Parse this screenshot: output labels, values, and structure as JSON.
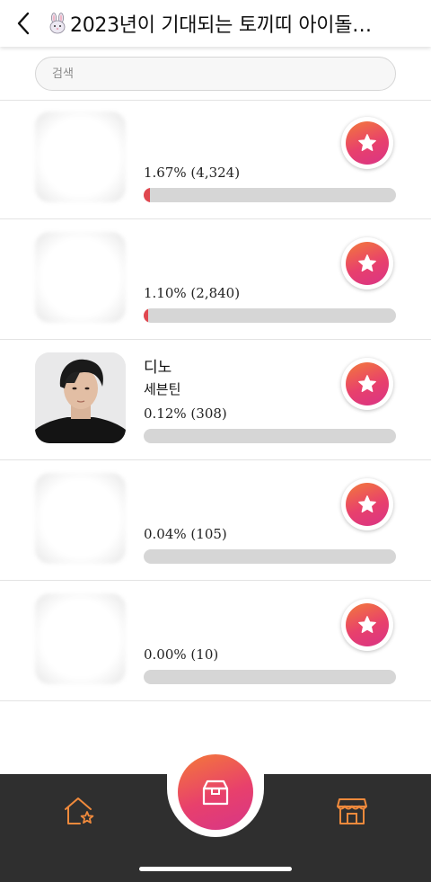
{
  "header": {
    "title": "2023년이 기대되는 토끼띠 아이돌…",
    "title_icon": "rabbit-emoji-icon",
    "back_icon": "chevron-left-icon"
  },
  "search": {
    "placeholder": "검색"
  },
  "candidates": [
    {
      "name": "",
      "group": "",
      "percent_text": "1.67% (4,324)",
      "percent": 1.67,
      "votes": 4324
    },
    {
      "name": "",
      "group": "",
      "percent_text": "1.10% (2,840)",
      "percent": 1.1,
      "votes": 2840
    },
    {
      "name": "디노",
      "group": "세븐틴",
      "percent_text": "0.12% (308)",
      "percent": 0.12,
      "votes": 308
    },
    {
      "name": "",
      "group": "",
      "percent_text": "0.04% (105)",
      "percent": 0.04,
      "votes": 105
    },
    {
      "name": "",
      "group": "",
      "percent_text": "0.00% (10)",
      "percent": 0.0,
      "votes": 10
    }
  ],
  "bottom_nav": {
    "left_icon": "home-star-icon",
    "center_icon": "box-icon",
    "right_icon": "store-icon"
  },
  "colors": {
    "accent_gradient_start": "#f37a3a",
    "accent_gradient_end": "#d93486",
    "bar_fill": "#e0474f",
    "nav_icon": "#f08a3c",
    "bottom_bar": "#2f2f2f"
  }
}
